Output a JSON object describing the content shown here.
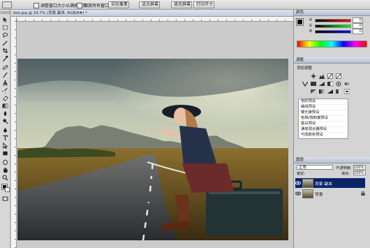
{
  "options_bar": {
    "checkbox_resize": "调整窗口大小以满屏显示",
    "checkbox_all_windows": "缩放所有窗口",
    "btn_actual_pixels": "实际像素",
    "btn_fit_screen": "适合屏幕",
    "btn_fill_screen": "填充屏幕",
    "btn_print_size": "打印尺寸"
  },
  "document": {
    "title": "kkk.jpg @ 33.7% (背景 副本, RGB/8#) *"
  },
  "color_panel": {
    "tab": "颜色",
    "channels": [
      {
        "label": "R",
        "value": "0"
      },
      {
        "label": "G",
        "value": "0"
      },
      {
        "label": "B",
        "value": "0"
      }
    ]
  },
  "adjust_panel": {
    "tab": "调整",
    "subtitle": "添加调整",
    "presets": [
      "色阶预设",
      "曲线预设",
      "曝光度预设",
      "色相/饱和度预设",
      "黑白预设",
      "通道混合器预设",
      "可选颜色预设"
    ]
  },
  "layers_panel": {
    "tab": "图层",
    "blend_mode": "正常",
    "opacity_label": "不透明度:",
    "opacity_value": "100%",
    "lock_label": "锁定:",
    "fill_label": "填充:",
    "fill_value": "100%",
    "layers": [
      {
        "name": "背景 副本",
        "selected": true
      },
      {
        "name": "背景",
        "selected": false
      }
    ]
  },
  "colors": {
    "foreground": "#000000",
    "background": "#ffffff",
    "selection": "#0a246a"
  }
}
